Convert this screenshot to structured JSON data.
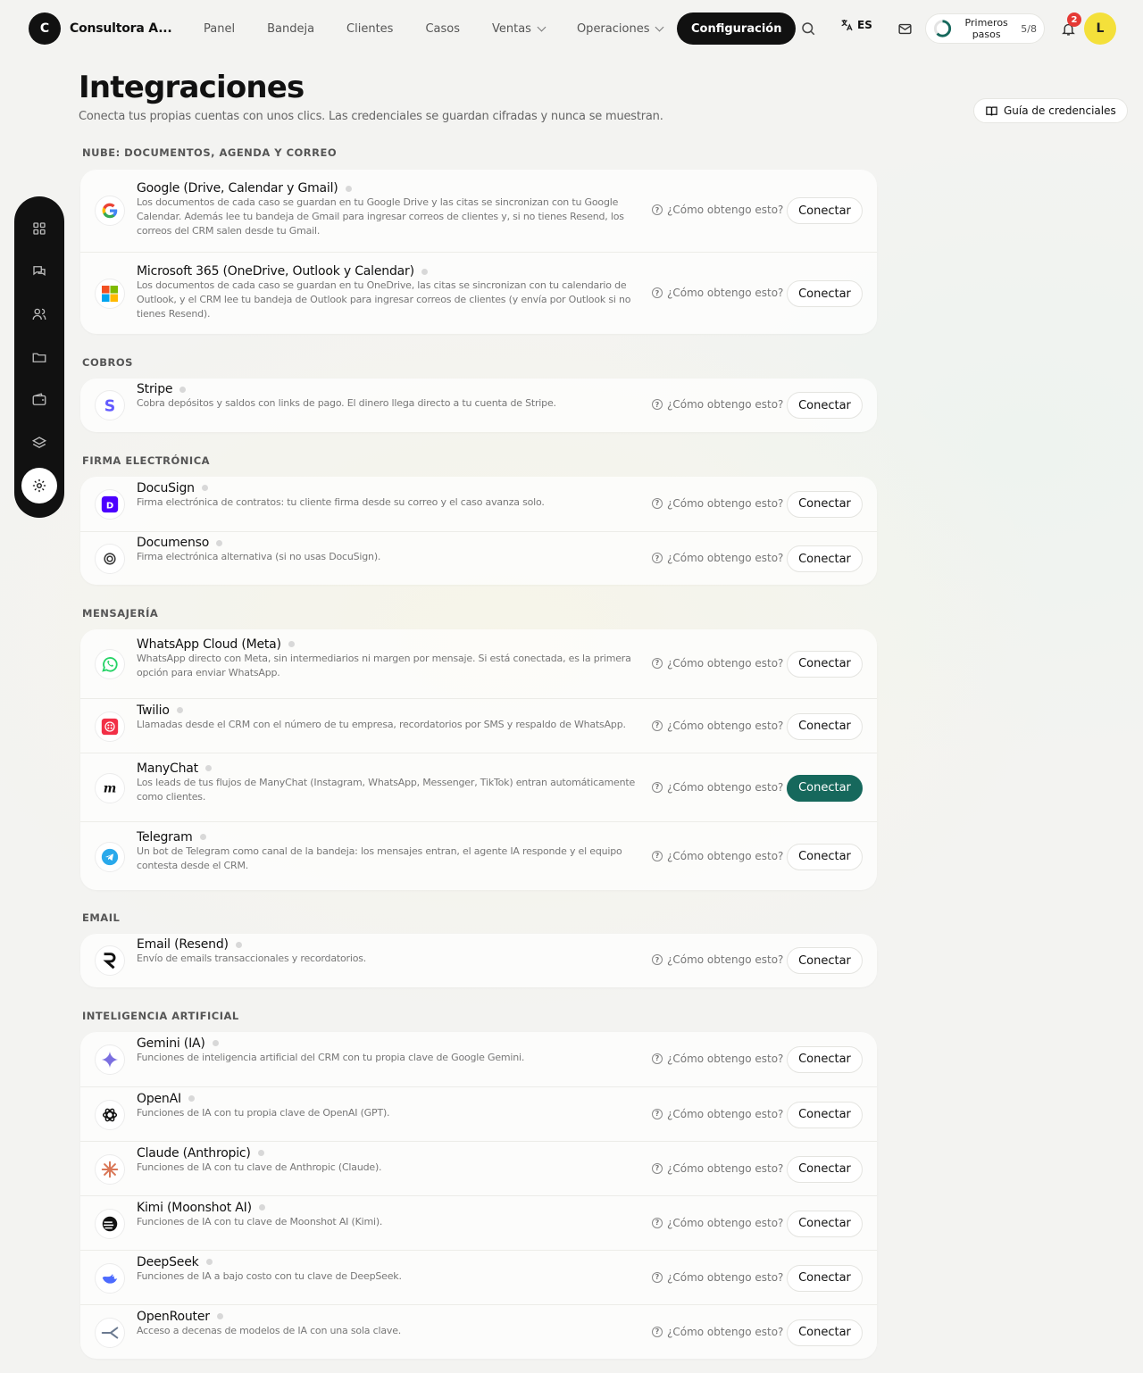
{
  "app": {
    "logo_letter": "C",
    "name": "Consultora A..."
  },
  "nav": {
    "items": [
      "Panel",
      "Bandeja",
      "Clientes",
      "Casos",
      "Ventas",
      "Operaciones"
    ],
    "active": "Configuración"
  },
  "topbar": {
    "lang": "ES",
    "steps_label": "Primeros pasos",
    "steps_count": "5/8",
    "notifications": "2",
    "avatar_letter": "L"
  },
  "page": {
    "title": "Integraciones",
    "subtitle": "Conecta tus propias cuentas con unos clics. Las credenciales se guardan cifradas y nunca se muestran.",
    "guide_button": "Guía de credenciales"
  },
  "help_label": "¿Cómo obtengo esto?",
  "connect_label": "Conectar",
  "colors": {
    "primary": "#16685c",
    "dark": "#111111",
    "accent_avatar": "#f4e03a",
    "badge": "#e53935"
  },
  "sections": [
    {
      "title": "NUBE: DOCUMENTOS, AGENDA Y CORREO",
      "items": [
        {
          "icon": "google-icon",
          "name": "Google (Drive, Calendar y Gmail)",
          "desc": "Los documentos de cada caso se guardan en tu Google Drive y las citas se sincronizan con tu Google Calendar. Además lee tu bandeja de Gmail para ingresar correos de clientes y, si no tienes Resend, los correos del CRM salen desde tu Gmail."
        },
        {
          "icon": "microsoft-icon",
          "name": "Microsoft 365 (OneDrive, Outlook y Calendar)",
          "desc": "Los documentos de cada caso se guardan en tu OneDrive, las citas se sincronizan con tu calendario de Outlook, y el CRM lee tu bandeja de Outlook para ingresar correos de clientes (y envía por Outlook si no tienes Resend)."
        }
      ]
    },
    {
      "title": "COBROS",
      "items": [
        {
          "icon": "stripe-icon",
          "name": "Stripe",
          "desc": "Cobra depósitos y saldos con links de pago. El dinero llega directo a tu cuenta de Stripe."
        }
      ]
    },
    {
      "title": "FIRMA ELECTRÓNICA",
      "items": [
        {
          "icon": "docusign-icon",
          "name": "DocuSign",
          "desc": "Firma electrónica de contratos: tu cliente firma desde su correo y el caso avanza solo."
        },
        {
          "icon": "documenso-icon",
          "name": "Documenso",
          "desc": "Firma electrónica alternativa (si no usas DocuSign)."
        }
      ]
    },
    {
      "title": "MENSAJERÍA",
      "items": [
        {
          "icon": "whatsapp-icon",
          "name": "WhatsApp Cloud (Meta)",
          "desc": "WhatsApp directo con Meta, sin intermediarios ni margen por mensaje. Si está conectada, es la primera opción para enviar WhatsApp."
        },
        {
          "icon": "twilio-icon",
          "name": "Twilio",
          "desc": "Llamadas desde el CRM con el número de tu empresa, recordatorios por SMS y respaldo de WhatsApp."
        },
        {
          "icon": "manychat-icon",
          "name": "ManyChat",
          "desc": "Los leads de tus flujos de ManyChat (Instagram, WhatsApp, Messenger, TikTok) entran automáticamente como clientes.",
          "primary": true
        },
        {
          "icon": "telegram-icon",
          "name": "Telegram",
          "desc": "Un bot de Telegram como canal de la bandeja: los mensajes entran, el agente IA responde y el equipo contesta desde el CRM."
        }
      ]
    },
    {
      "title": "EMAIL",
      "items": [
        {
          "icon": "resend-icon",
          "name": "Email (Resend)",
          "desc": "Envío de emails transaccionales y recordatorios."
        }
      ]
    },
    {
      "title": "INTELIGENCIA ARTIFICIAL",
      "items": [
        {
          "icon": "gemini-icon",
          "name": "Gemini (IA)",
          "desc": "Funciones de inteligencia artificial del CRM con tu propia clave de Google Gemini."
        },
        {
          "icon": "openai-icon",
          "name": "OpenAI",
          "desc": "Funciones de IA con tu propia clave de OpenAI (GPT)."
        },
        {
          "icon": "claude-icon",
          "name": "Claude (Anthropic)",
          "desc": "Funciones de IA con tu clave de Anthropic (Claude)."
        },
        {
          "icon": "kimi-icon",
          "name": "Kimi (Moonshot AI)",
          "desc": "Funciones de IA con tu clave de Moonshot AI (Kimi)."
        },
        {
          "icon": "deepseek-icon",
          "name": "DeepSeek",
          "desc": "Funciones de IA a bajo costo con tu clave de DeepSeek."
        },
        {
          "icon": "openrouter-icon",
          "name": "OpenRouter",
          "desc": "Acceso a decenas de modelos de IA con una sola clave."
        }
      ]
    }
  ]
}
